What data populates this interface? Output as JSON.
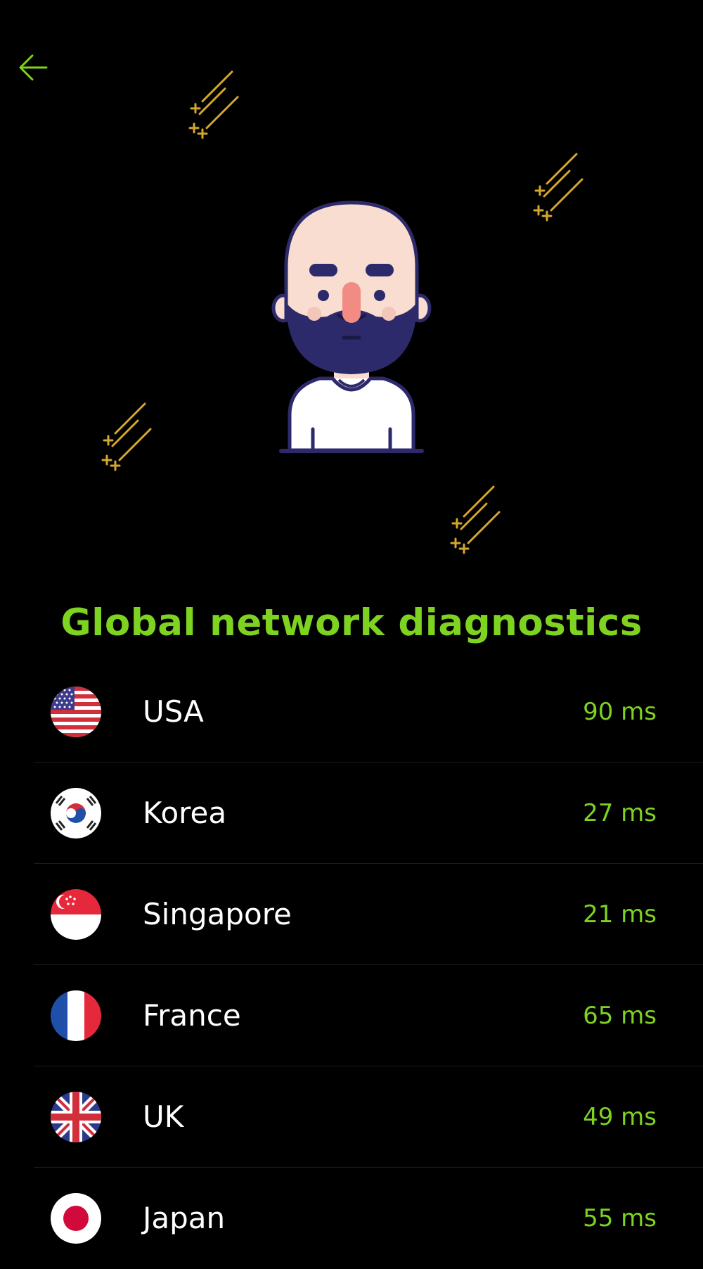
{
  "header": {
    "back_icon": "arrow-left-icon",
    "accent_color": "#7ed321"
  },
  "illustration": {
    "icon": "bearded-man-avatar",
    "decoration_icon": "shooting-star-icon",
    "decoration_color": "#d4a72c"
  },
  "title": "Global network diagnostics",
  "servers": [
    {
      "country": "USA",
      "latency": "90 ms",
      "flag_icon": "flag-usa-icon"
    },
    {
      "country": "Korea",
      "latency": "27 ms",
      "flag_icon": "flag-korea-icon"
    },
    {
      "country": "Singapore",
      "latency": "21 ms",
      "flag_icon": "flag-singapore-icon"
    },
    {
      "country": "France",
      "latency": "65 ms",
      "flag_icon": "flag-france-icon"
    },
    {
      "country": "UK",
      "latency": "49 ms",
      "flag_icon": "flag-uk-icon"
    },
    {
      "country": "Japan",
      "latency": "55 ms",
      "flag_icon": "flag-japan-icon"
    }
  ]
}
